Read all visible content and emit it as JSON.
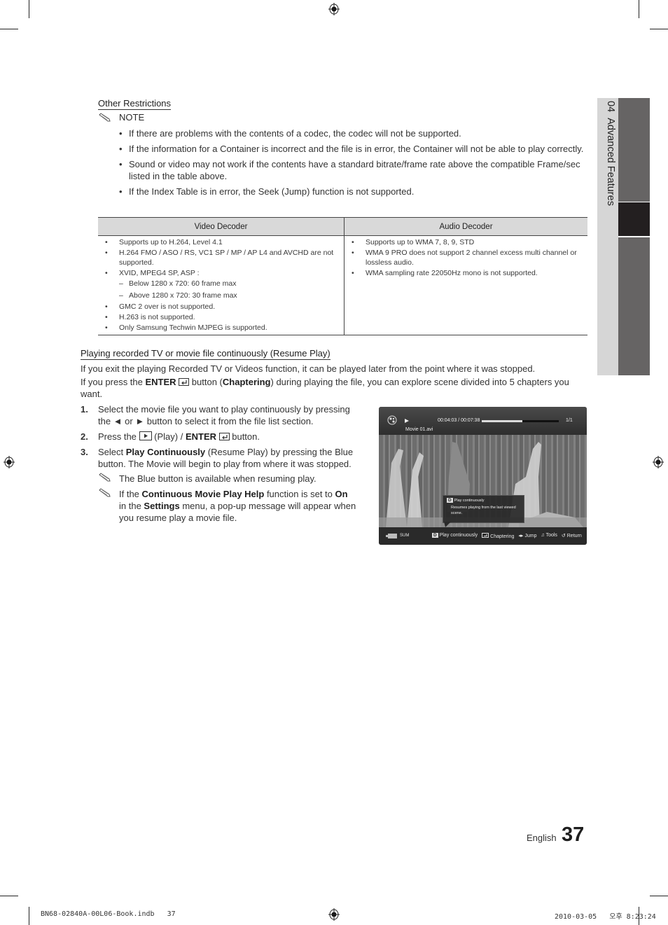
{
  "other_restrictions": {
    "heading": "Other Restrictions",
    "note_label": "NOTE",
    "notes": [
      "If there are problems with the contents of a codec, the codec will not be supported.",
      "If the information for a Container is incorrect and the file is in error, the Container will not be able to play correctly.",
      "Sound or video may not work if the contents have a standard bitrate/frame rate above the compatible Frame/sec listed in the table above.",
      "If the Index Table is in error, the Seek (Jump) function is not supported."
    ]
  },
  "codec_table": {
    "headers": [
      "Video Decoder",
      "Audio Decoder"
    ],
    "video": [
      {
        "type": "bullet",
        "text": "Supports up to H.264, Level 4.1"
      },
      {
        "type": "bullet",
        "text": "H.264 FMO / ASO / RS, VC1 SP / MP / AP L4 and AVCHD are not supported."
      },
      {
        "type": "bullet",
        "text": "XVID, MPEG4 SP, ASP :"
      },
      {
        "type": "dash",
        "text": "Below 1280 x 720: 60 frame max"
      },
      {
        "type": "dash",
        "text": "Above 1280 x 720: 30 frame max"
      },
      {
        "type": "bullet",
        "text": "GMC 2 over is not supported."
      },
      {
        "type": "bullet",
        "text": "H.263 is not supported."
      },
      {
        "type": "bullet",
        "text": "Only Samsung Techwin MJPEG is supported."
      }
    ],
    "audio": [
      {
        "type": "bullet",
        "text": "Supports up to WMA 7, 8, 9, STD"
      },
      {
        "type": "bullet",
        "text": "WMA 9 PRO does not support 2 channel excess multi channel or lossless audio."
      },
      {
        "type": "bullet",
        "text": "WMA sampling rate 22050Hz mono is not supported."
      }
    ]
  },
  "resume_play": {
    "heading": "Playing recorded TV or movie file continuously (Resume Play)",
    "intro1": "If you exit the playing Recorded TV or Videos function, it can be played later from the point where it was stopped.",
    "intro2_a": "If you press the ",
    "intro2_enter": "ENTER",
    "intro2_b": " button (",
    "intro2_chaptering": "Chaptering",
    "intro2_c": ") during playing the file, you can explore scene divided into 5 chapters you want.",
    "steps": [
      {
        "num": "1.",
        "text": "Select the movie file you want to play continuously by pressing the ◄ or ► button to select it from the file list section."
      },
      {
        "num": "2.",
        "a": "Press the ",
        "b": " (Play) / ",
        "enter": "ENTER",
        "c": " button."
      },
      {
        "num": "3.",
        "a": "Select ",
        "bold": "Play Continuously",
        "b": " (Resume Play) by pressing the Blue button. The Movie will begin to play from where it was stopped."
      }
    ],
    "note1": "The Blue button is available when resuming play.",
    "note2": {
      "a": "If the ",
      "b1": "Continuous Movie Play Help",
      "b": " function is set to ",
      "b2": "On",
      "c": " in the ",
      "b3": "Settings",
      "d": " menu, a pop-up message will appear when you resume play a movie file."
    }
  },
  "tv_screen": {
    "time": "00:04:03 / 00:07:38",
    "progress_fraction": 0.53,
    "page": "1/1",
    "filename": "Movie 01.avi",
    "popup_key": "D",
    "popup_title": "Play continuously",
    "popup_body": "Resumes playing from the last viewed scene.",
    "device_label": "SUM",
    "bottom_bar": [
      {
        "icon": "d-key-icon",
        "key": "D",
        "label": "Play continuously"
      },
      {
        "icon": "enter-icon",
        "label": "Chaptering"
      },
      {
        "icon": "left-right-icon",
        "label": "Jump"
      },
      {
        "icon": "tools-icon",
        "label": "Tools"
      },
      {
        "icon": "return-icon",
        "label": "Return"
      }
    ]
  },
  "side_tab": {
    "number": "04",
    "title": "Advanced Features"
  },
  "footer": {
    "language": "English",
    "page_number": "37",
    "file_info": "BN68-02840A-00L06-Book.indb   37",
    "timestamp": "2010-03-05   오후 8:23:24"
  }
}
